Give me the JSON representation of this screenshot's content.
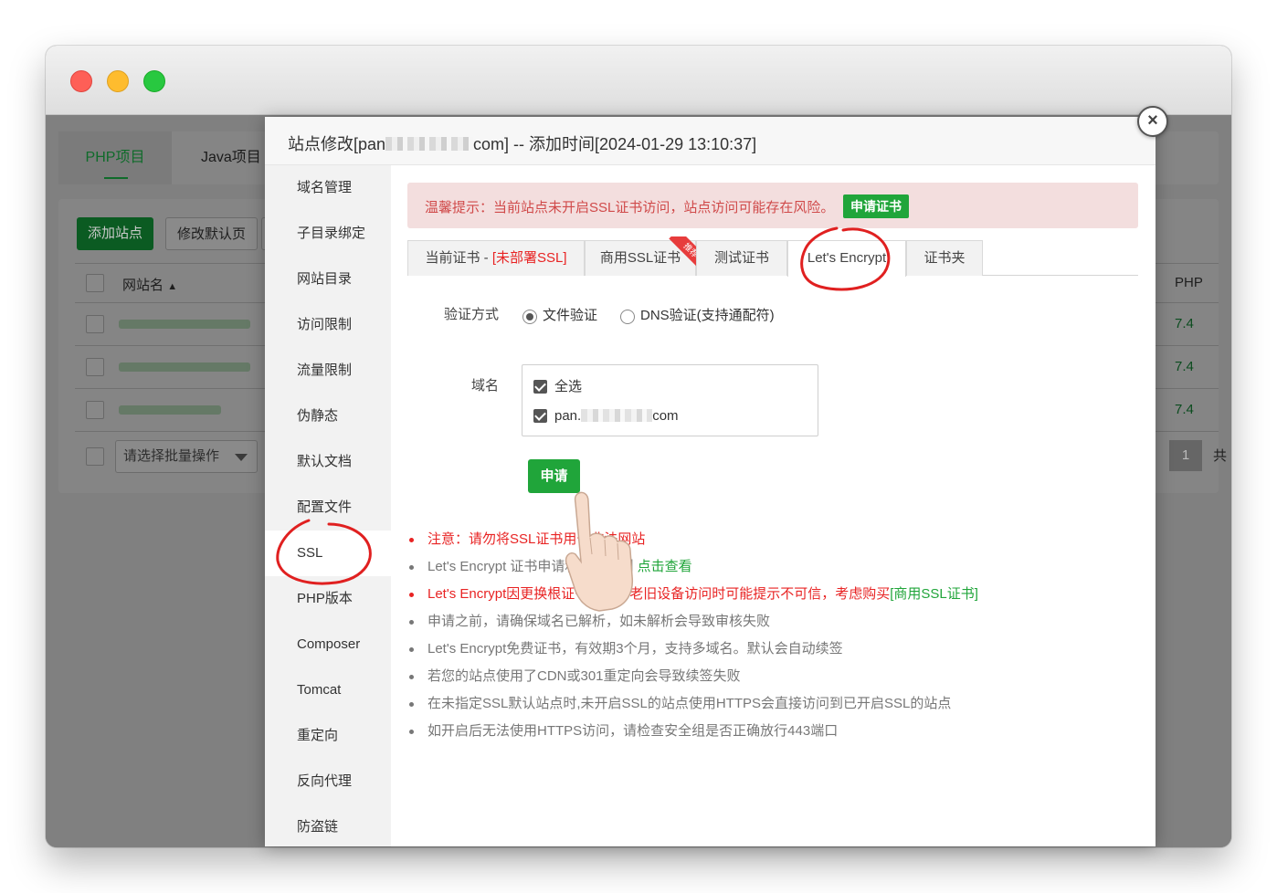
{
  "window": {
    "controls": [
      "close",
      "minimize",
      "maximize"
    ]
  },
  "background": {
    "tabs": [
      "PHP项目",
      "Java项目"
    ],
    "buttons": {
      "add_site": "添加站点",
      "modify_default": "修改默认页"
    },
    "table": {
      "col_site": "网站名",
      "col_php": "PHP",
      "sort_icon": "caret-up-icon",
      "php_values": [
        "7.4",
        "7.4",
        "7.4"
      ]
    },
    "batch_select": "请选择批量操作",
    "pagination": {
      "page": "1",
      "total": "共"
    }
  },
  "modal": {
    "title_prefix": "站点修改[pan",
    "title_suffix": "com] -- 添加时间[2024-01-29 13:10:37]",
    "close_icon": "close-icon",
    "nav": [
      "域名管理",
      "子目录绑定",
      "网站目录",
      "访问限制",
      "流量限制",
      "伪静态",
      "默认文档",
      "配置文件",
      "SSL",
      "PHP版本",
      "Composer",
      "Tomcat",
      "重定向",
      "反向代理",
      "防盗链"
    ],
    "nav_active": "SSL",
    "alert": {
      "text": "温馨提示：当前站点未开启SSL证书访问，站点访问可能存在风险。",
      "button": "申请证书"
    },
    "tabs": {
      "current_prefix": "当前证书 - ",
      "current_status": "[未部署SSL]",
      "commercial": "商用SSL证书",
      "recommend_badge": "推荐",
      "test": "测试证书",
      "letsencrypt": "Let's Encrypt",
      "folder": "证书夹"
    },
    "verify": {
      "label": "验证方式",
      "options": [
        "文件验证",
        "DNS验证(支持通配符)"
      ],
      "selected": "文件验证"
    },
    "domain": {
      "label": "域名",
      "select_all": "全选",
      "prefix": "pan.",
      "suffix": "com"
    },
    "apply_button": "申请",
    "notes": [
      {
        "text": "注意：请勿将SSL证书用于非法网站"
      },
      {
        "text": "Let's Encrypt 证书申请和续签限制",
        "link": "点击查看"
      },
      {
        "text": "Let's Encrypt因更换根证书，部分老旧设备访问时可能提示不可信，考虑购买",
        "link": "[商用SSL证书]"
      },
      {
        "text": "申请之前，请确保域名已解析，如未解析会导致审核失败"
      },
      {
        "text": "Let's Encrypt免费证书，有效期3个月，支持多域名。默认会自动续签"
      },
      {
        "text": "若您的站点使用了CDN或301重定向会导致续签失败"
      },
      {
        "text": "在未指定SSL默认站点时,未开启SSL的站点使用HTTPS会直接访问到已开启SSL的站点"
      },
      {
        "text": "如开启后无法使用HTTPS访问，请检查安全组是否正确放行443端口"
      }
    ]
  },
  "colors": {
    "accent": "#20a53a",
    "danger": "#e82323",
    "annotation": "#e02020"
  },
  "annotations": [
    "pointing-hand-icon",
    "red-circle-annotation"
  ]
}
